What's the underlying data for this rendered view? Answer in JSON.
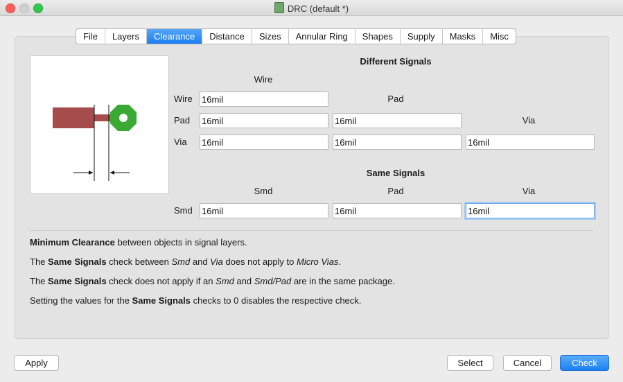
{
  "window": {
    "title": "DRC (default *)"
  },
  "tabs": [
    "File",
    "Layers",
    "Clearance",
    "Distance",
    "Sizes",
    "Annular Ring",
    "Shapes",
    "Supply",
    "Masks",
    "Misc"
  ],
  "active_tab": "Clearance",
  "different_signals": {
    "heading": "Different Signals",
    "col_wire": "Wire",
    "col_pad": "Pad",
    "col_via": "Via",
    "row_wire": "Wire",
    "row_pad": "Pad",
    "row_via": "Via",
    "wire_wire": "16mil",
    "pad_wire": "16mil",
    "pad_pad": "16mil",
    "via_wire": "16mil",
    "via_pad": "16mil",
    "via_via": "16mil"
  },
  "same_signals": {
    "heading": "Same Signals",
    "col_smd": "Smd",
    "col_pad": "Pad",
    "col_via": "Via",
    "row_smd": "Smd",
    "smd_smd": "16mil",
    "smd_pad": "16mil",
    "smd_via": "16mil"
  },
  "description": {
    "line1_b1": "Minimum Clearance",
    "line1_t1": " between objects in signal layers.",
    "line2_t1": "The ",
    "line2_b1": "Same Signals",
    "line2_t2": " check between ",
    "line2_i1": "Smd",
    "line2_t3": " and ",
    "line2_i2": "Via",
    "line2_t4": " does not apply to ",
    "line2_i3": "Micro Vias",
    "line2_t5": ".",
    "line3_t1": "The ",
    "line3_b1": "Same Signals",
    "line3_t2": " check does not apply if an ",
    "line3_i1": "Smd",
    "line3_t3": " and ",
    "line3_i2": "Smd/Pad",
    "line3_t4": " are in the same package.",
    "line4_t1": "Setting the values for the ",
    "line4_b1": "Same Signals",
    "line4_t2": " checks to 0 disables the respective check."
  },
  "buttons": {
    "apply": "Apply",
    "select": "Select",
    "cancel": "Cancel",
    "check": "Check"
  },
  "colors": {
    "accent": "#1a7ef2",
    "wire": "#a04848",
    "via": "#3aaa35"
  },
  "icons": [
    "app-icon"
  ]
}
